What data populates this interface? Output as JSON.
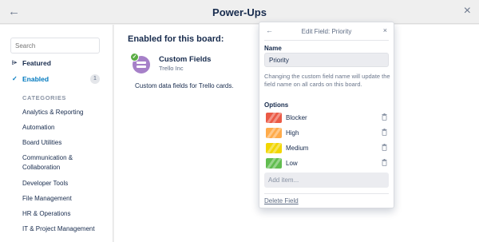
{
  "header": {
    "title": "Power-Ups",
    "back_icon": "←",
    "close_icon": "×"
  },
  "sidebar": {
    "search_placeholder": "Search",
    "featured_label": "Featured",
    "featured_icon": "⌲",
    "enabled_label": "Enabled",
    "enabled_icon": "✓",
    "enabled_count": "1",
    "categories_heading": "CATEGORIES",
    "categories": [
      "Analytics & Reporting",
      "Automation",
      "Board Utilities",
      "Communication &\nCollaboration",
      "Developer Tools",
      "File Management",
      "HR & Operations",
      "IT & Project Management"
    ]
  },
  "main": {
    "heading": "Enabled for this board:",
    "powerup": {
      "name": "Custom Fields",
      "vendor": "Trello Inc",
      "description": "Custom data fields for Trello cards.",
      "icon_color": "#a680c8"
    }
  },
  "popover": {
    "title": "Edit Field: Priority",
    "back_icon": "←",
    "close_icon": "×",
    "name_label": "Name",
    "name_value": "Priority",
    "help_text": "Changing the custom field name will update the field name on all cards on this board.",
    "options_label": "Options",
    "options": [
      {
        "label": "Blocker",
        "color": "#eb5a46"
      },
      {
        "label": "High",
        "color": "#ffab4a"
      },
      {
        "label": "Medium",
        "color": "#f2d600"
      },
      {
        "label": "Low",
        "color": "#61bd4f"
      }
    ],
    "add_item_placeholder": "Add item...",
    "delete_label": "Delete Field"
  }
}
